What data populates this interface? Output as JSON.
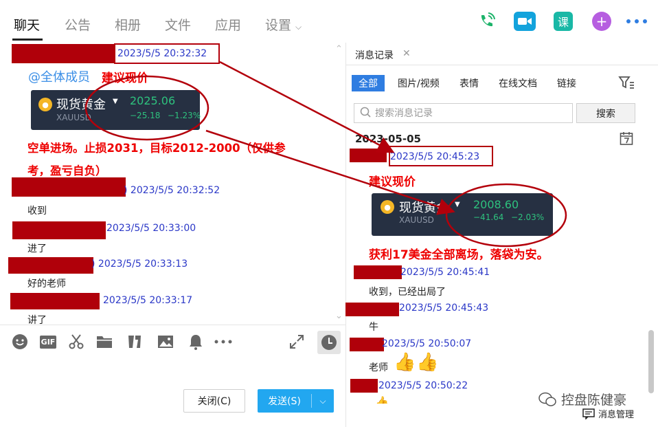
{
  "topbar": {
    "tabs": [
      {
        "label": "聊天"
      },
      {
        "label": "公告"
      },
      {
        "label": "相册"
      },
      {
        "label": "文件"
      },
      {
        "label": "应用"
      },
      {
        "label": "设置"
      }
    ],
    "active_tab": "聊天",
    "tools": [
      "phone-icon",
      "video-call-icon",
      "course-icon",
      "add-icon",
      "more-icon"
    ],
    "course_label": "课",
    "add_label": "+"
  },
  "chat": {
    "mention": "@全体成员",
    "headline": "建议现价",
    "first_ts": "2023/5/5 20:32:32",
    "quote": {
      "name": "现货黄金",
      "code": "XAUUSD",
      "price": "2025.06",
      "change": "−25.18",
      "pct": "−1.23%"
    },
    "instruction": "空单进场。止损2031，目标2012-2000（仅供参考，盈亏自负）",
    "instruction_line1": "空单进场。止损2031，目标2012-2000（仅供参",
    "instruction_line2": "考，盈亏自负）",
    "messages": [
      {
        "prefix": ")",
        "ts": "2023/5/5 20:32:52",
        "text": "收到"
      },
      {
        "prefix": "",
        "ts": "2023/5/5 20:33:00",
        "text": "进了"
      },
      {
        "prefix": ")",
        "ts": "2023/5/5 20:33:13",
        "text": "好的老师"
      },
      {
        "prefix": "",
        "ts": "2023/5/5 20:33:17",
        "text": "讲了"
      }
    ]
  },
  "composer": {
    "tools": [
      "emoji-icon",
      "gif-icon",
      "scissors-icon",
      "folder-icon",
      "shake-icon",
      "image-icon",
      "bell-icon",
      "more-icon",
      "expand-icon",
      "history-icon"
    ],
    "gif_label": "GIF",
    "close_label": "关闭(C)",
    "send_label": "发送(S)"
  },
  "history": {
    "tab_label": "消息记录",
    "filters": [
      "全部",
      "图片/视频",
      "表情",
      "在线文档",
      "链接"
    ],
    "active_filter": "全部",
    "search_placeholder": "搜索消息记录",
    "search_button": "搜索",
    "date": "2023-05-05",
    "first_ts": "2023/5/5 20:45:23",
    "headline": "建议现价",
    "quote": {
      "name": "现货黄金",
      "code": "XAUUSD",
      "price": "2008.60",
      "change": "−41.64",
      "pct": "−2.03%"
    },
    "profit_note": "获利17美金全部离场，落袋为安。",
    "messages": [
      {
        "ts": "2023/5/5 20:45:41",
        "text": "收到，已经出局了"
      },
      {
        "ts": "2023/5/5 20:45:43",
        "text": "牛"
      },
      {
        "ts": "2023/5/5 20:50:07",
        "text": "老师"
      },
      {
        "ts": "2023/5/5 20:50:22",
        "text": ""
      }
    ],
    "msg_mgmt": "消息管理"
  },
  "watermark": "控盘陈健豪",
  "colors": {
    "accent_blue": "#2f7de1",
    "timestamp_blue": "#2a37c7",
    "annotation_red": "#e00000",
    "redaction": "#b0000a",
    "quote_green": "#2ec27e"
  }
}
